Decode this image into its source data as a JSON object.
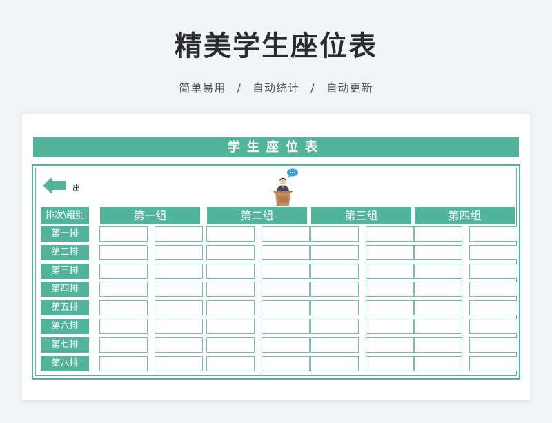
{
  "title": "精美学生座位表",
  "subtitle": {
    "parts": [
      "简单易用",
      "自动统计",
      "自动更新"
    ],
    "separator": "/"
  },
  "sheet": {
    "header": "学生座位表",
    "exit_label": "出",
    "corner_label": "排次\\组别",
    "groups": [
      "第一组",
      "第二组",
      "第三组",
      "第四组"
    ],
    "rows": [
      "第一排",
      "第二排",
      "第三排",
      "第四排",
      "第五排",
      "第六排",
      "第七排",
      "第八排"
    ],
    "seats_per_group": 2,
    "seats": [
      [
        "",
        "",
        "",
        "",
        "",
        "",
        "",
        ""
      ],
      [
        "",
        "",
        "",
        "",
        "",
        "",
        "",
        ""
      ],
      [
        "",
        "",
        "",
        "",
        "",
        "",
        "",
        ""
      ],
      [
        "",
        "",
        "",
        "",
        "",
        "",
        "",
        ""
      ],
      [
        "",
        "",
        "",
        "",
        "",
        "",
        "",
        ""
      ],
      [
        "",
        "",
        "",
        "",
        "",
        "",
        "",
        ""
      ],
      [
        "",
        "",
        "",
        "",
        "",
        "",
        "",
        ""
      ],
      [
        "",
        "",
        "",
        "",
        "",
        "",
        "",
        ""
      ]
    ]
  },
  "colors": {
    "accent": "#52b59b",
    "seat_border": "#6fc2ab",
    "background": "#f2f3f5"
  },
  "icons": {
    "exit": "arrow-left-icon",
    "teacher": "teacher-podium-icon"
  }
}
